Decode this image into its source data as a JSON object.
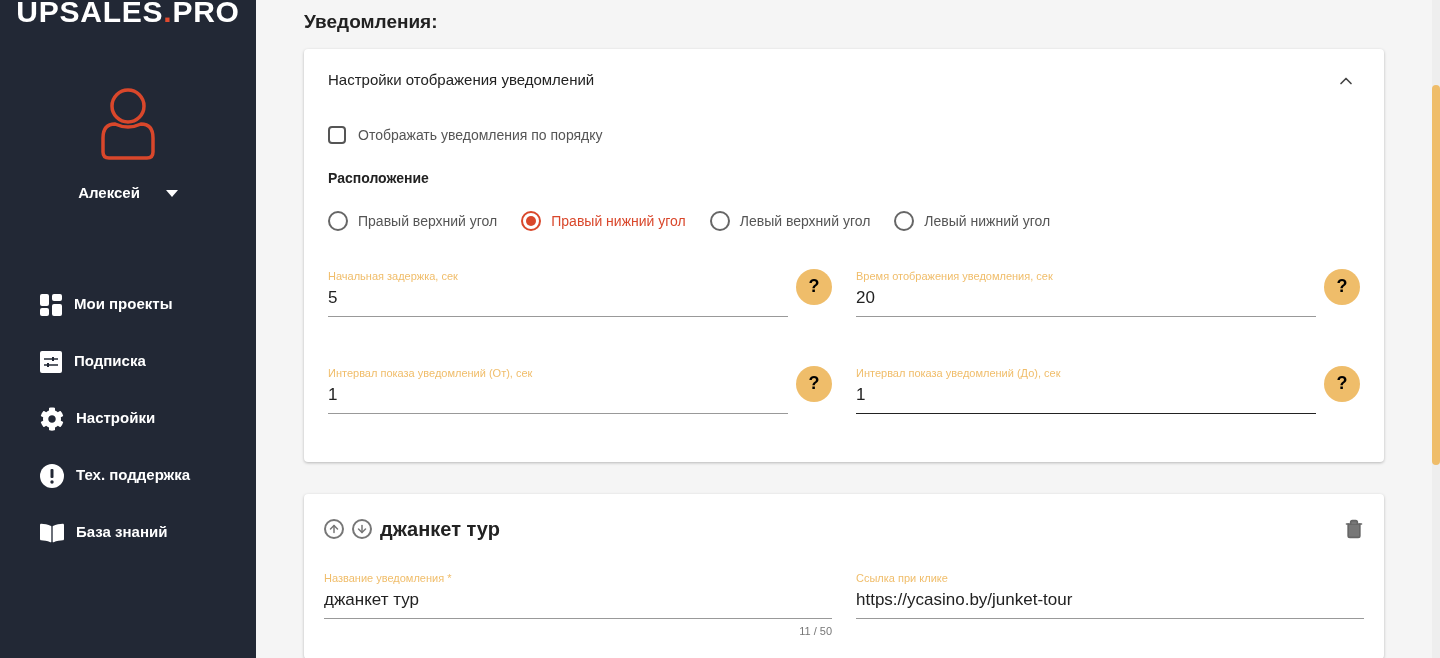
{
  "logo": {
    "before": "UPSALES",
    "dot": ".",
    "after": "PRO"
  },
  "user": {
    "name": "Алексей"
  },
  "sidebar": {
    "items": [
      {
        "label": "Мои проекты",
        "kind": "grid"
      },
      {
        "label": "Подписка",
        "kind": "sliders"
      },
      {
        "label": "Настройки",
        "kind": "gear"
      },
      {
        "label": "Тех. поддержка",
        "kind": "alert"
      },
      {
        "label": "База знаний",
        "kind": "book"
      }
    ]
  },
  "page_title": "Уведомления:",
  "display_settings": {
    "title": "Настройки отображения уведомлений",
    "expanded": true,
    "ordered_checkbox": {
      "label": "Отображать уведомления по порядку",
      "checked": false
    },
    "position_label": "Расположение",
    "positions": [
      {
        "label": "Правый верхний угол",
        "selected": false
      },
      {
        "label": "Правый нижний угол",
        "selected": true
      },
      {
        "label": "Левый верхний угол",
        "selected": false
      },
      {
        "label": "Левый нижний угол",
        "selected": false
      }
    ],
    "fields": [
      {
        "label": "Начальная задержка, сек",
        "value": "5",
        "help": "?",
        "focused": false
      },
      {
        "label": "Время отображения уведомления, сек",
        "value": "20",
        "help": "?",
        "focused": false
      },
      {
        "label": "Интервал показа уведомлений (От), сек",
        "value": "1",
        "help": "?",
        "focused": false
      },
      {
        "label": "Интервал показа уведомлений (До), сек",
        "value": "1",
        "help": "?",
        "focused": true
      }
    ]
  },
  "notification": {
    "title": "джанкет тур",
    "fields": [
      {
        "label": "Название уведомления *",
        "value": "джанкет тур",
        "counter": "11 / 50"
      },
      {
        "label": "Ссылка при клике",
        "value": "https://ycasino.by/junket-tour"
      }
    ]
  }
}
